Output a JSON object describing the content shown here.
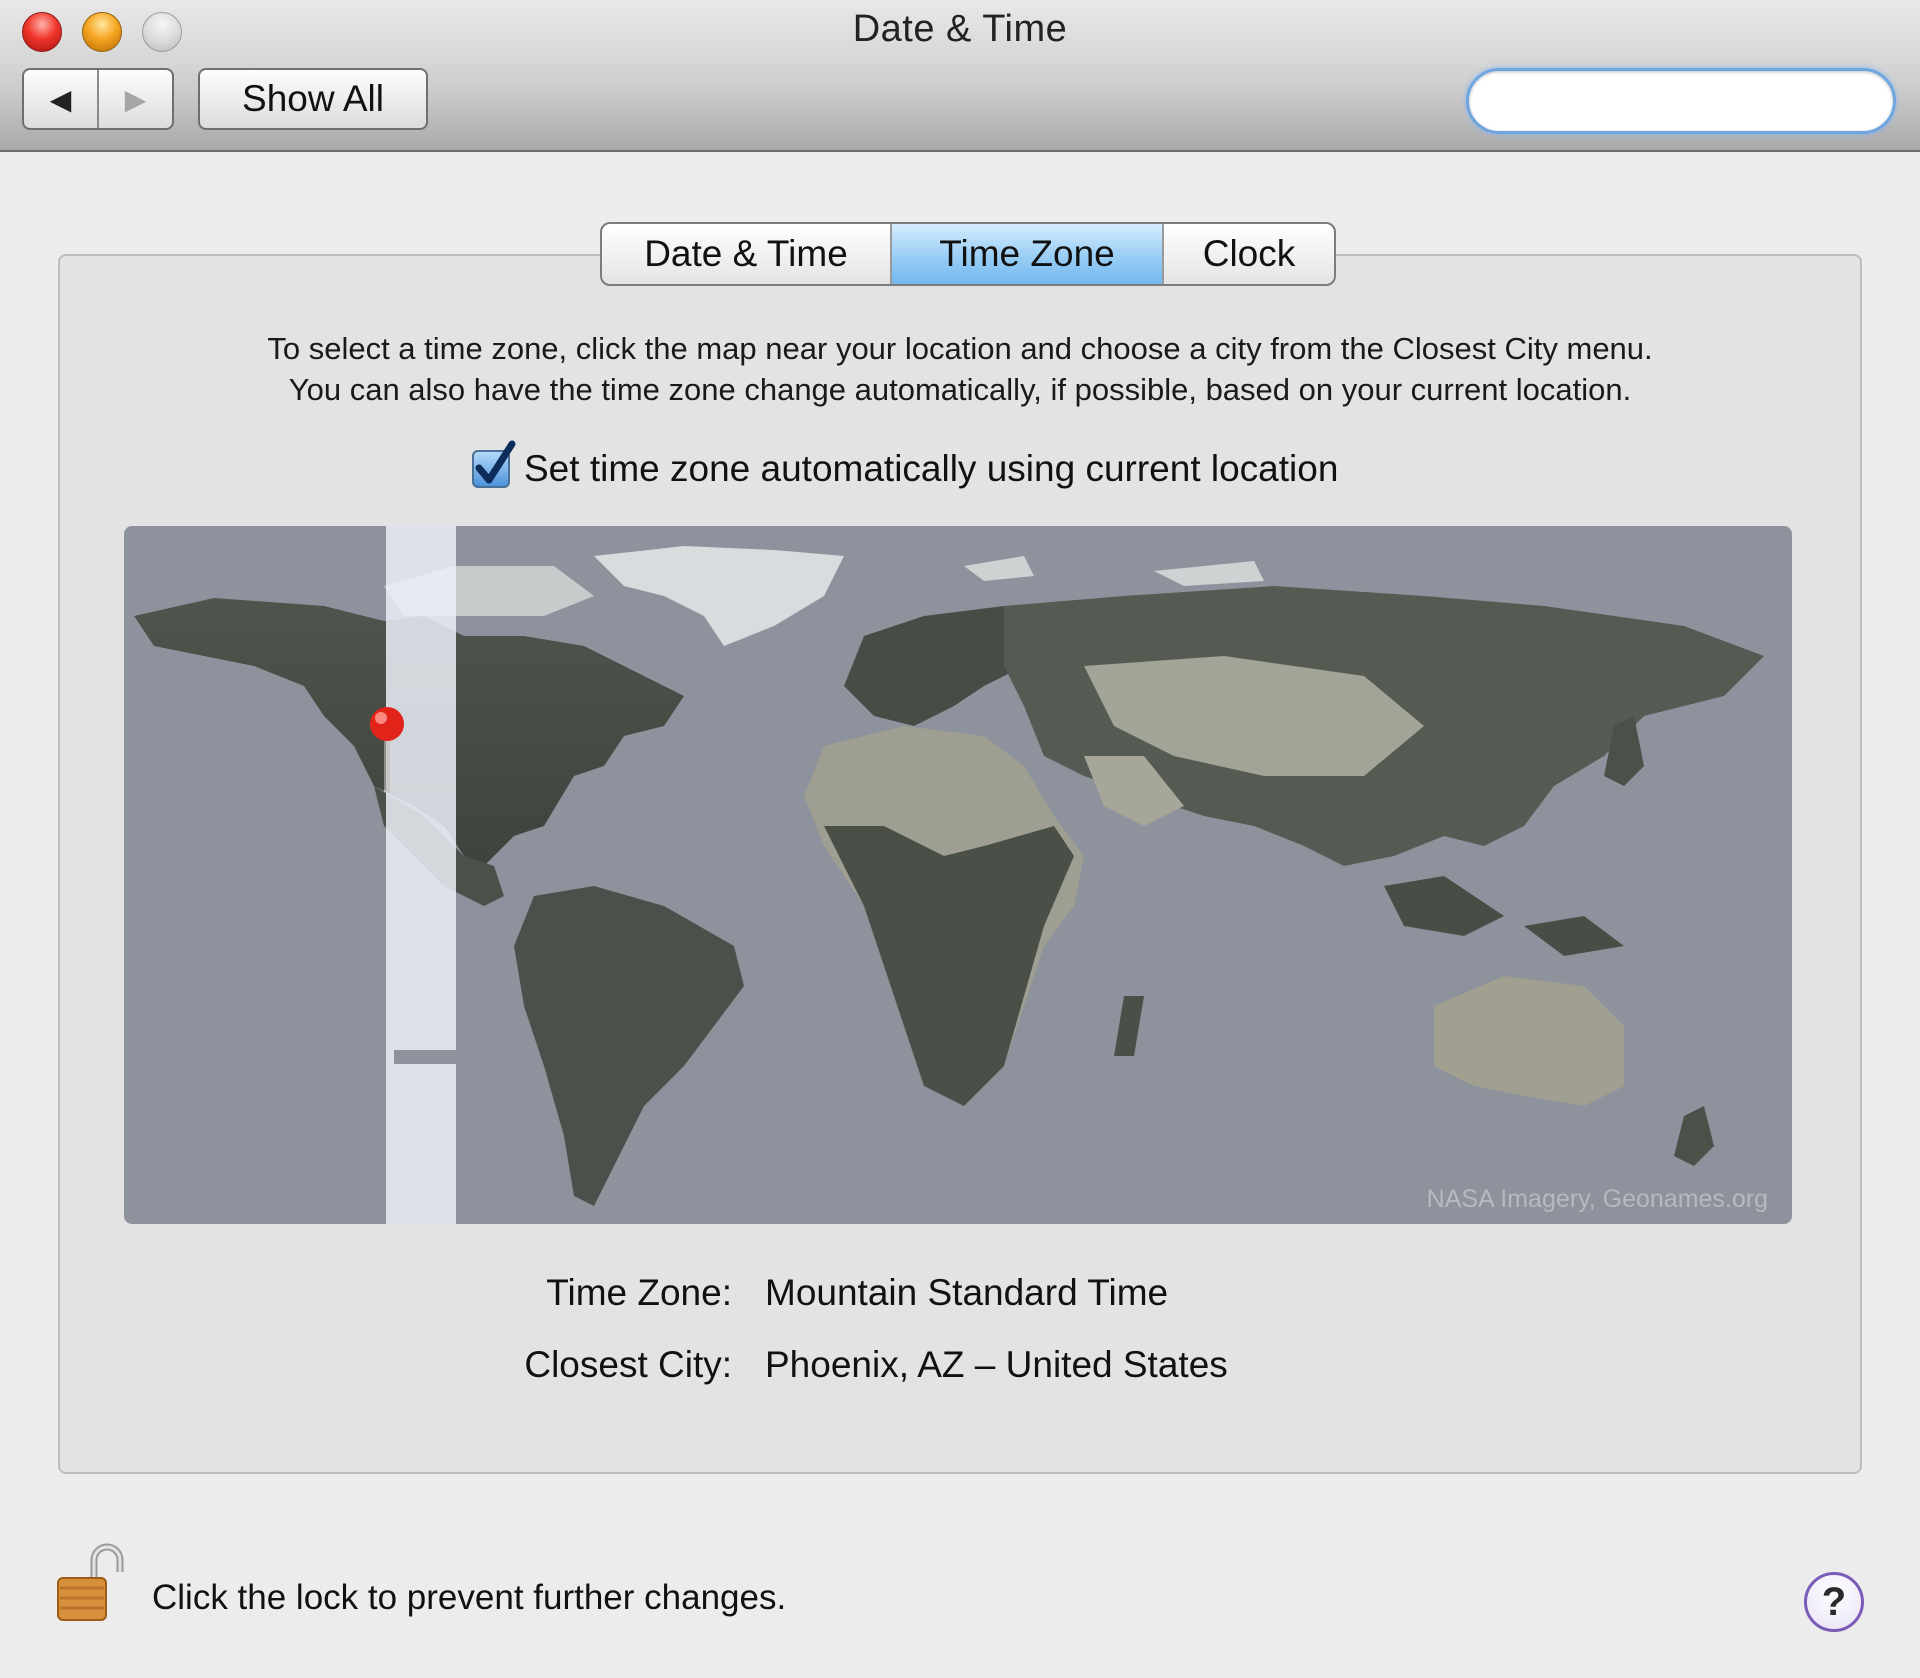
{
  "window": {
    "title": "Date & Time"
  },
  "toolbar": {
    "back_icon": "◀",
    "forward_icon": "▶",
    "show_all_label": "Show All",
    "search_value": "",
    "search_placeholder": ""
  },
  "tabs": [
    {
      "label": "Date & Time",
      "selected": false
    },
    {
      "label": "Time Zone",
      "selected": true
    },
    {
      "label": "Clock",
      "selected": false
    }
  ],
  "time_zone_pane": {
    "instructions_line1": "To select a time zone, click the map near your location and choose a city from the Closest City menu.",
    "instructions_line2": "You can also have the time zone change automatically, if possible, based on your current location.",
    "auto_checkbox_label": "Set time zone automatically using current location",
    "auto_checked": true,
    "map_credit": "NASA Imagery, Geonames.org",
    "time_zone_label": "Time Zone:",
    "time_zone_value": "Mountain Standard Time",
    "closest_city_label": "Closest City:",
    "closest_city_value": "Phoenix, AZ – United States"
  },
  "footer": {
    "lock_label": "Click the lock to prevent further changes.",
    "help_label": "?"
  },
  "colors": {
    "ocean": "#8d929c",
    "selected_tab": "#9ed0f6",
    "search_focus_ring": "#6fa6e0",
    "pin": "#e2231a"
  }
}
